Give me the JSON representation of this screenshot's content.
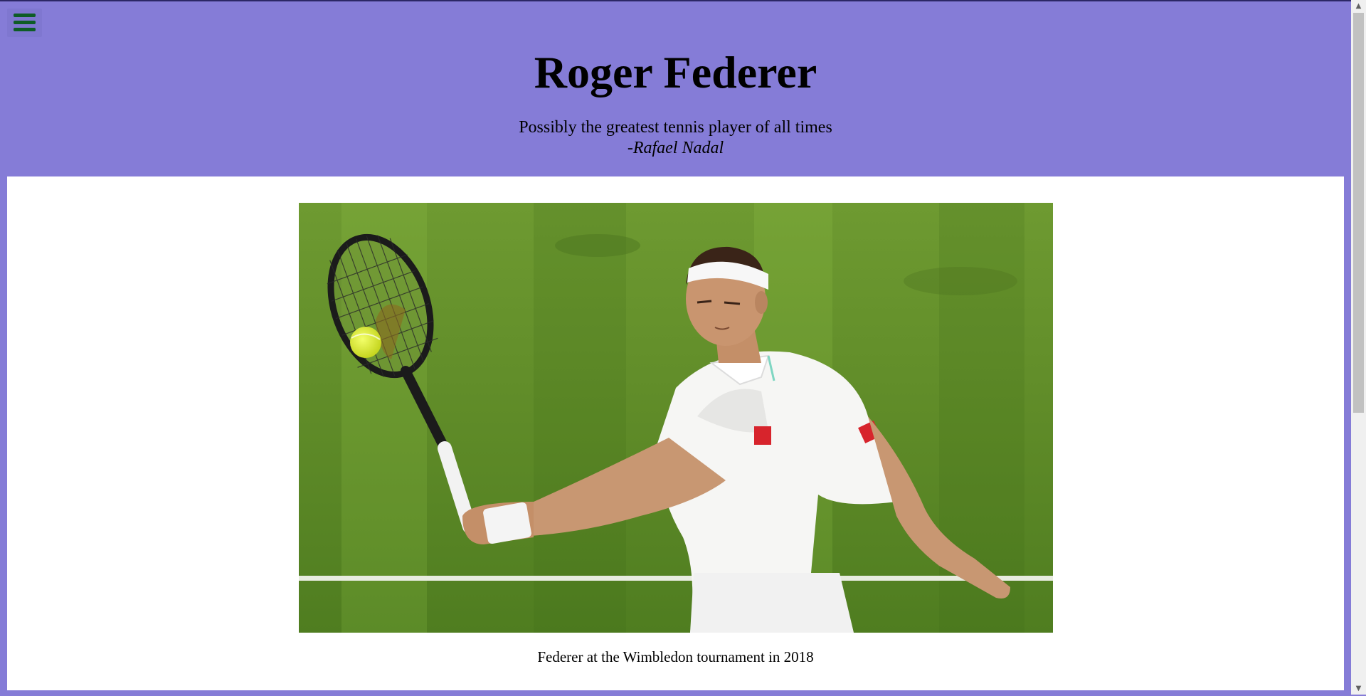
{
  "header": {
    "title": "Roger Federer",
    "quote_text": "Possibly the greatest tennis player of all times",
    "quote_author": "-Rafael Nadal",
    "menu_icon": "hamburger-icon"
  },
  "main": {
    "image_alt": "Roger Federer hitting a forehand on a grass court",
    "caption": "Federer at the Wimbledon tournament in 2018"
  },
  "colors": {
    "background": "#857cd7",
    "content": "#ffffff",
    "menu_icon": "#0e5c26"
  }
}
